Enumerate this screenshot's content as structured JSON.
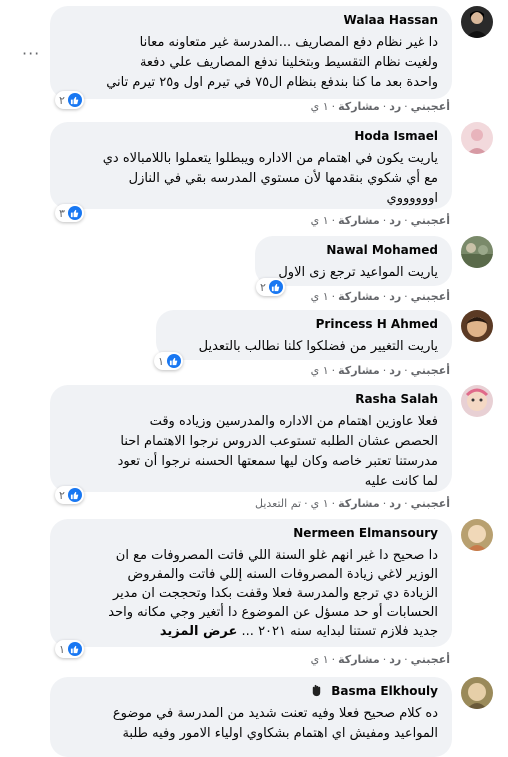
{
  "actions": {
    "like": "أعجبني",
    "reply": "رد",
    "share": "مشاركة",
    "edited": "تم التعديل"
  },
  "more_options": "···",
  "comments": [
    {
      "author": "Walaa Hassan",
      "lines": [
        "دا غير نظام دفع المصاريف ...المدرسة غير متعاونه معانا",
        "ولغيت نظام التقسيط وبتخلينا ندفع المصاريف علي دفعة",
        "واحدة بعد ما كنا بندفع بنظام ال٧٥ في تيرم اول و٢٥ تيرم تاني"
      ],
      "reactions": "٢",
      "time": "١ ي"
    },
    {
      "author": "Hoda Ismael",
      "lines": [
        "ياريت يكون في اهتمام من الاداره ويبطلوا يتعملوا باللامبالاه دي",
        "مع أي شكوي بنقدمها لأن مستوي المدرسه بقي في النازل",
        "اووووووي"
      ],
      "reactions": "٣",
      "time": "١ ي"
    },
    {
      "author": "Nawal Mohamed",
      "lines": [
        "ياريت المواعيد ترجع زى الاول"
      ],
      "reactions": "٢",
      "time": "١ ي"
    },
    {
      "author": "Princess H Ahmed",
      "lines": [
        "ياريت التغيير من فضلكوا كلنا نطالب بالتعديل"
      ],
      "reactions": "١",
      "time": "١ ي"
    },
    {
      "author": "Rasha Salah",
      "lines": [
        "فعلا عاوزين اهتمام من الاداره والمدرسين وزياده وقت",
        "الحصص عشان الطلبه تستوعب الدروس نرجوا الاهتمام احنا",
        "مدرستنا تعتبر خاصه وكان ليها سمعتها الحسنه نرجوا أن تعود",
        "لما كانت عليه"
      ],
      "reactions": "٢",
      "time": "١ ي",
      "edited": true
    },
    {
      "author": "Nermeen Elmansoury",
      "lines": [
        "دا صحيح دا غير انهم غلو السنة اللي فاتت المصروفات مع ان",
        "الوزير لاغي زيادة المصروفات السنه إللي فاتت والمفروض",
        "الزيادة دي ترجع والمدرسة فعلا وقفت بكدا وتحججت ان مدير",
        "الحسابات أو حد مسؤل عن الموضوع دا أتغير وجي مكانه واحد",
        "جديد فلازم تستنا لبدايه سنه ٢٠٢١ ..."
      ],
      "see_more": "عرض المزيد",
      "reactions": "١",
      "time": "١ ي"
    },
    {
      "author": "Basma Elkhouly",
      "lines": [
        "ده كلام صحيح فعلا وفيه تعنت شديد من المدرسة في موضوع",
        "المواعيد ومفيش اي اهتمام بشكاوي اولياء الامور وفيه طلبة"
      ]
    }
  ]
}
